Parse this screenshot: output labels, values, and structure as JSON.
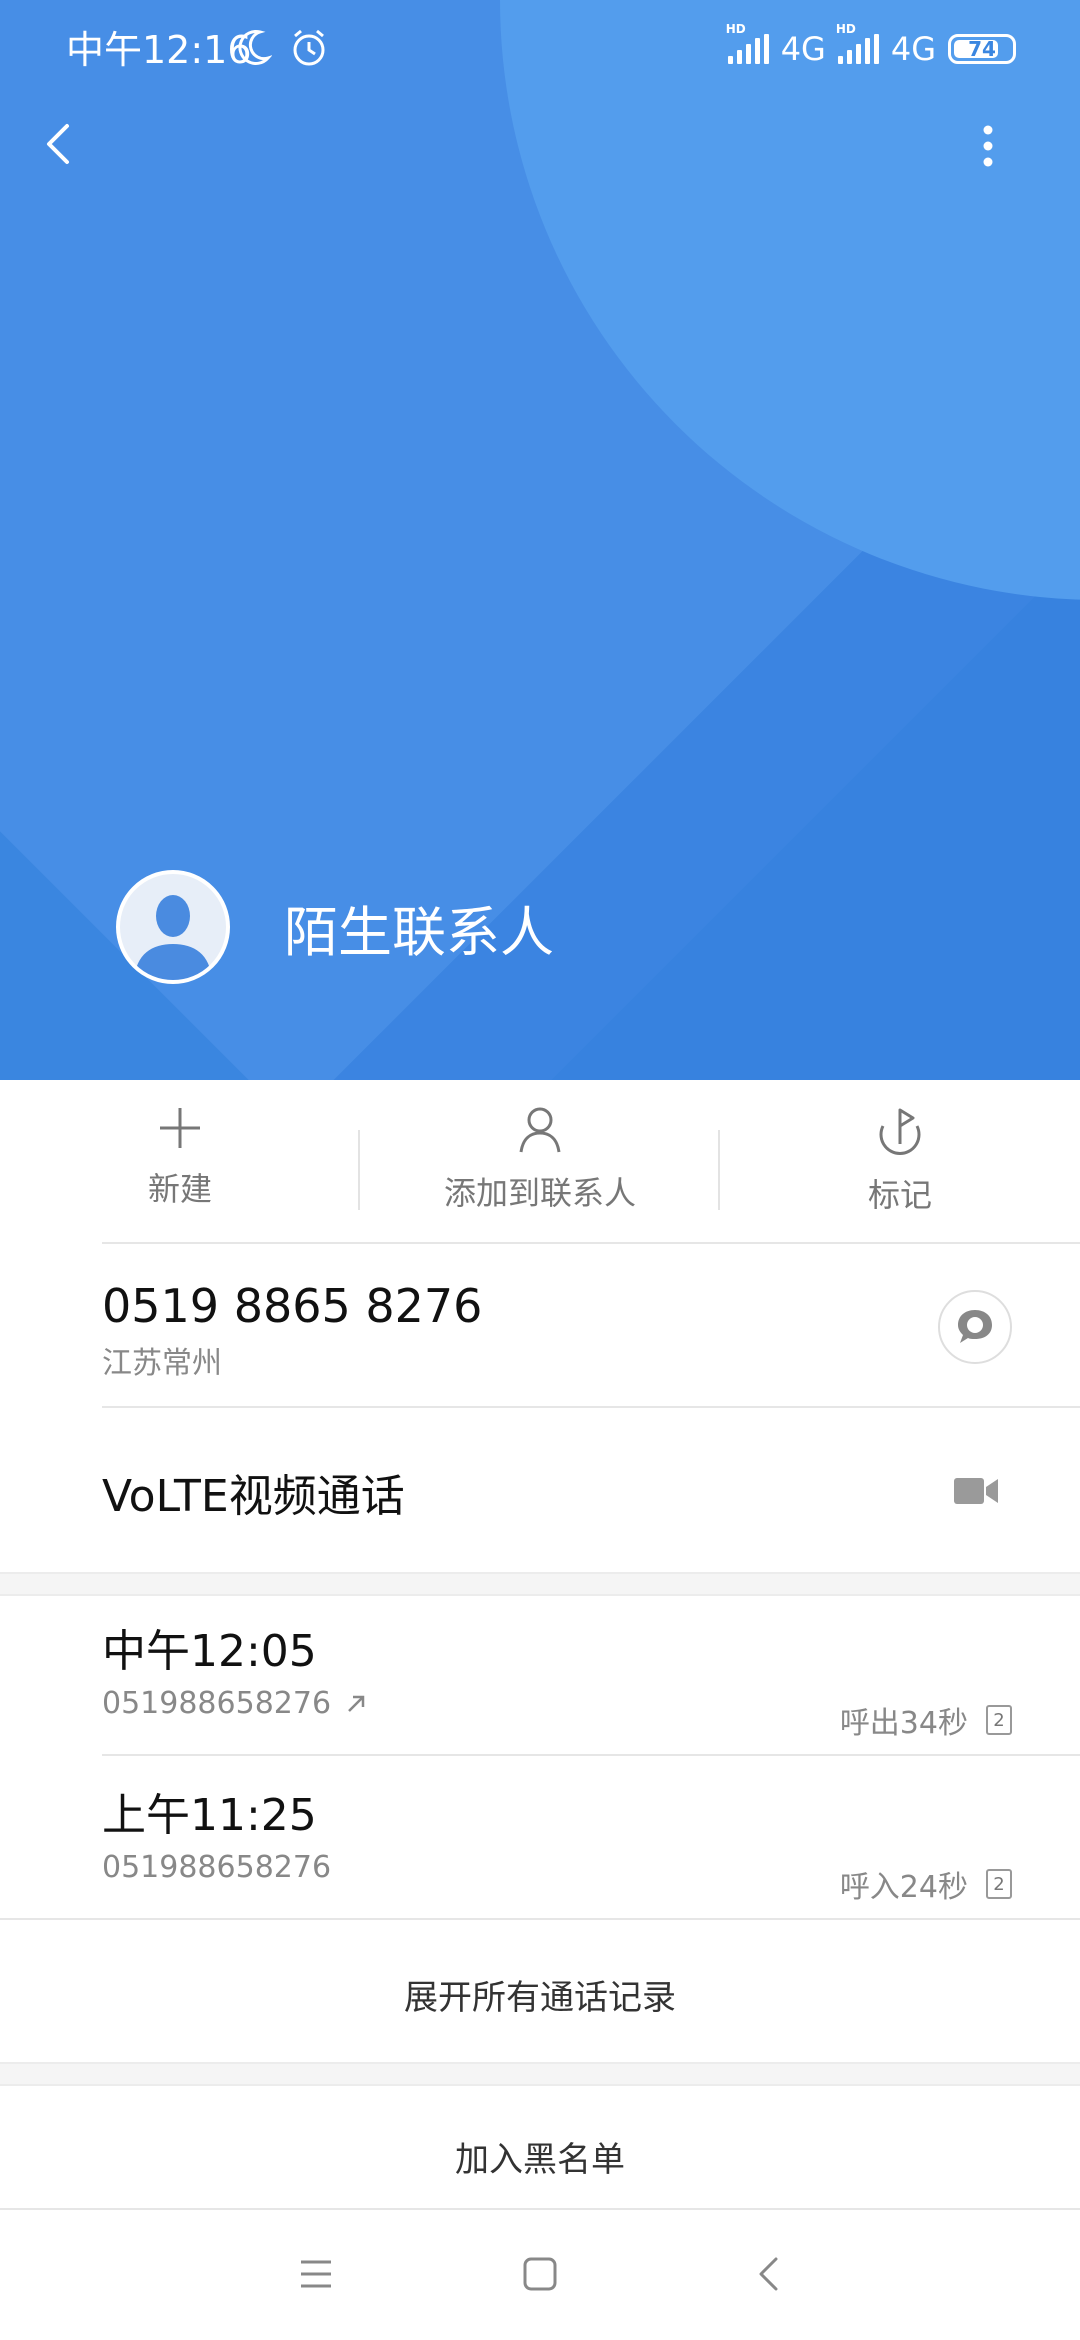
{
  "status_bar": {
    "time": "中午12:16",
    "network_1": "4G",
    "network_2": "4G",
    "hd_label": "HD",
    "battery": "74"
  },
  "contact": {
    "name": "陌生联系人"
  },
  "actions": [
    {
      "label": "新建",
      "icon": "plus-icon"
    },
    {
      "label": "添加到联系人",
      "icon": "person-icon"
    },
    {
      "label": "标记",
      "icon": "flag-icon"
    }
  ],
  "number": {
    "value": "0519 8865 8276",
    "location": "江苏常州"
  },
  "volte": {
    "label": "VoLTE视频通话"
  },
  "calls": [
    {
      "time": "中午12:05",
      "number": "051988658276",
      "direction": "outgoing",
      "duration": "呼出34秒",
      "sim": "2"
    },
    {
      "time": "上午11:25",
      "number": "051988658276",
      "direction": "incoming",
      "duration": "呼入24秒",
      "sim": "2"
    }
  ],
  "expand_label": "展开所有通话记录",
  "blacklist_label": "加入黑名单",
  "colors": {
    "header": "#3a86e0",
    "accent_light": "#539ded"
  }
}
